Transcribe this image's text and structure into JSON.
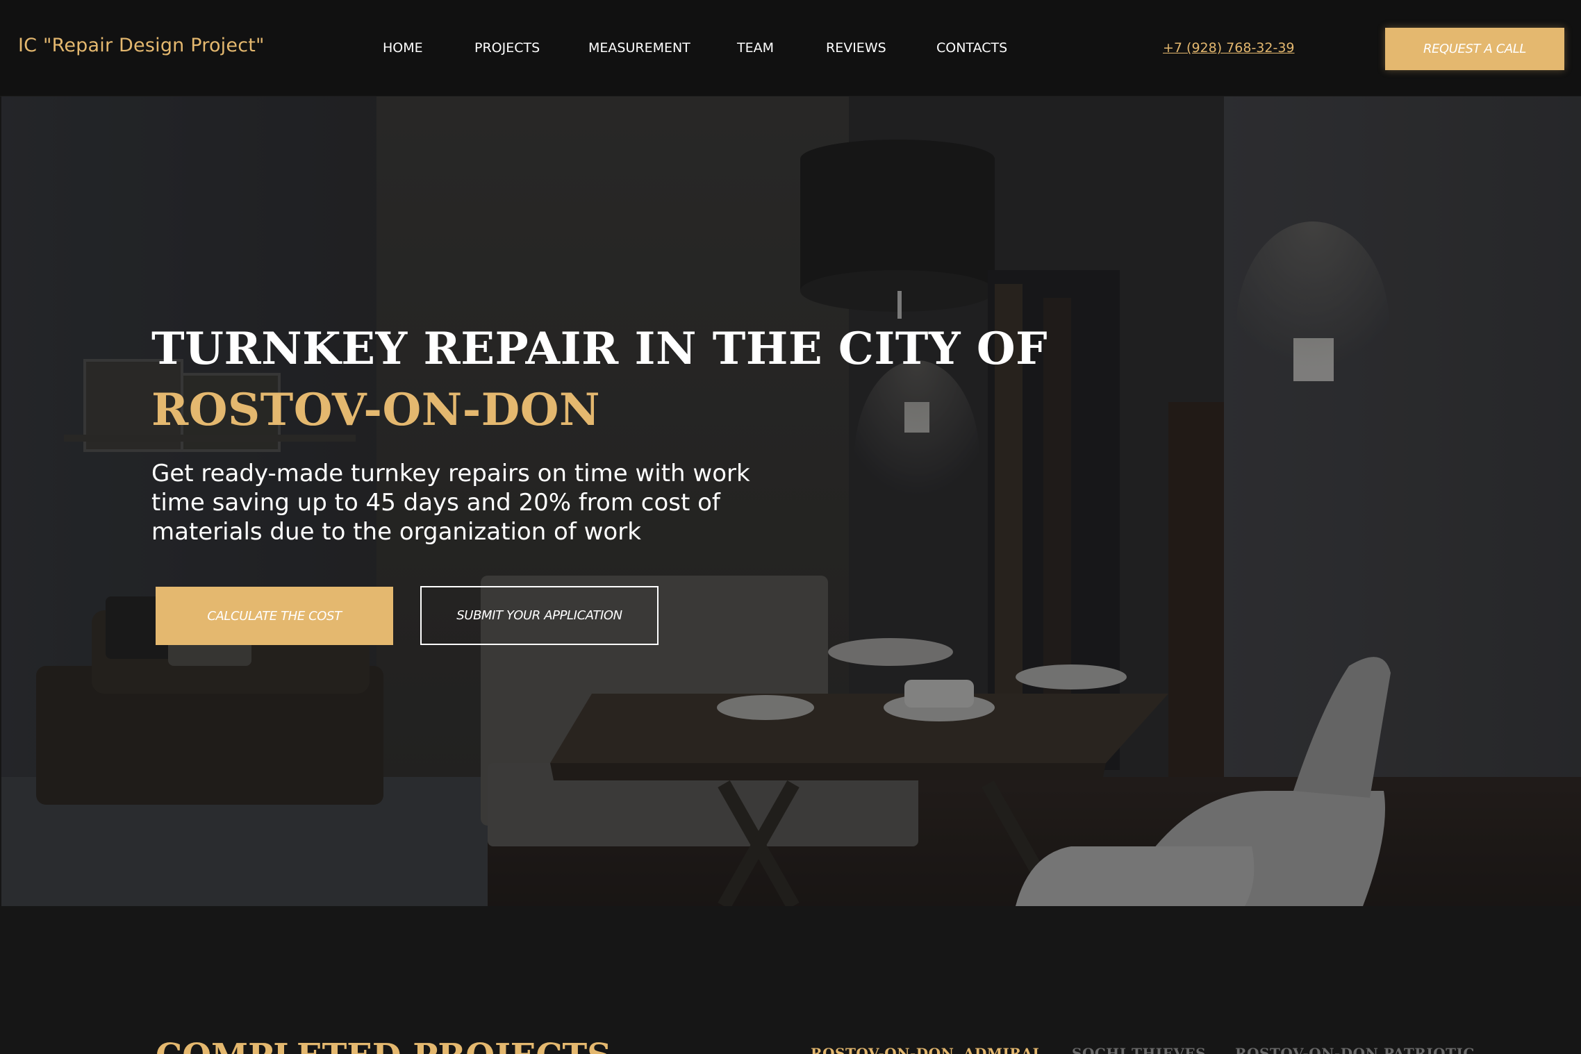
{
  "header": {
    "logo": "IC \"Repair Design Project\"",
    "nav": [
      {
        "label": "HOME"
      },
      {
        "label": "PROJECTS"
      },
      {
        "label": "MEASUREMENT"
      },
      {
        "label": "TEAM"
      },
      {
        "label": "REVIEWS"
      },
      {
        "label": "CONTACTS"
      }
    ],
    "phone": "+7 (928) 768-32-39",
    "request_label": "REQUEST A CALL"
  },
  "hero": {
    "title_line1": "TURNKEY REPAIR IN THE CITY OF",
    "title_line2": "ROSTOV-ON-DON",
    "subtitle": "Get ready-made turnkey repairs on time with work time saving up to 45 days and 20% from cost of materials due to the organization of work",
    "calc_label": "CALCULATE THE COST",
    "submit_label": "SUBMIT YOUR APPLICATION"
  },
  "projects": {
    "title": "COMPLETED PROJECTS",
    "tabs": [
      {
        "label": "ROSTOV-ON-DON, ADMIRAL",
        "active": true
      },
      {
        "label": "SOCHI THIEVES",
        "active": false
      },
      {
        "label": "ROSTOV-ON-DON PATRIOTIC",
        "active": false
      }
    ]
  },
  "colors": {
    "accent": "#e4b86f",
    "header_bg": "#111111",
    "page_bg": "#161616"
  }
}
